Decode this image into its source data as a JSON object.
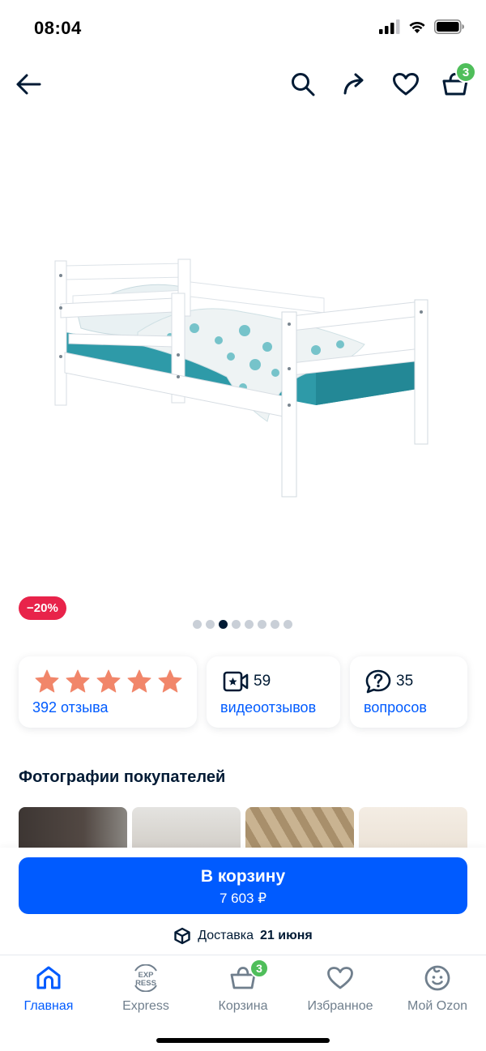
{
  "status_bar": {
    "time": "08:04"
  },
  "header": {
    "cart_count": "3"
  },
  "product": {
    "discount": "−20%",
    "gallery_total": 8,
    "gallery_active": 2
  },
  "stats": {
    "rating": {
      "stars": 5,
      "label": "392 отзыва"
    },
    "videos": {
      "count": "59",
      "label": "видеоотзывов"
    },
    "questions": {
      "count": "35",
      "label": "вопросов"
    }
  },
  "photos_section": {
    "title": "Фотографии покупателей"
  },
  "cart_button": {
    "label": "В корзину",
    "price": "7 603 ₽"
  },
  "delivery": {
    "prefix": "Доставка",
    "date": "21 июня"
  },
  "tab_bar": {
    "items": [
      {
        "label": "Главная",
        "icon": "home-icon"
      },
      {
        "label": "Express",
        "icon": "express-icon",
        "icon_text_top": "EXP",
        "icon_text_bottom": "RESS"
      },
      {
        "label": "Корзина",
        "icon": "cart-icon",
        "badge": "3"
      },
      {
        "label": "Избранное",
        "icon": "heart-icon"
      },
      {
        "label": "Мой Ozon",
        "icon": "profile-icon"
      }
    ]
  },
  "colors": {
    "accent": "#005bff",
    "badge_green": "#4fbe5a",
    "discount_red": "#e8234a",
    "star": "#f1866a"
  }
}
